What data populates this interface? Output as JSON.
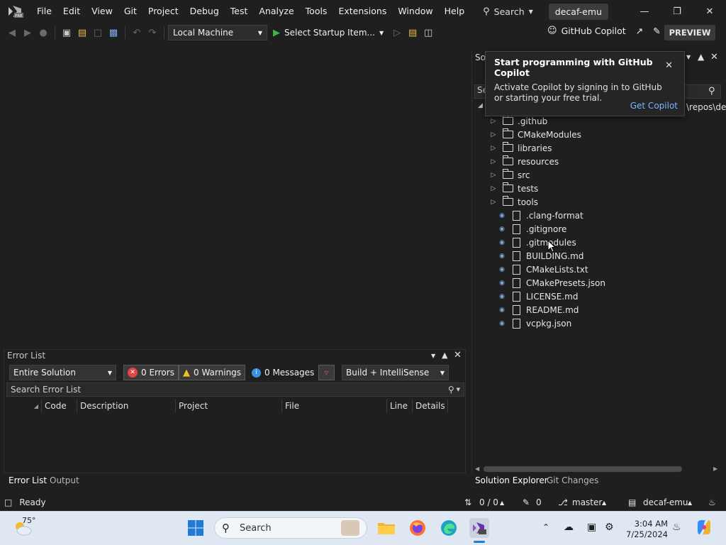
{
  "menubar": {
    "items": [
      "File",
      "Edit",
      "View",
      "Git",
      "Project",
      "Debug",
      "Test",
      "Analyze",
      "Tools",
      "Extensions",
      "Window",
      "Help"
    ],
    "search_label": "Search",
    "solution_name": "decaf-emu",
    "logo_badge": "PRE"
  },
  "toolbar": {
    "target": "Local Machine",
    "startup_label": "Select Startup Item...",
    "copilot_label": "GitHub Copilot",
    "preview_label": "PREVIEW"
  },
  "copilot_popup": {
    "title": "Start programming with GitHub Copilot",
    "text": "Activate Copilot by signing in to GitHub or starting your free trial.",
    "link": "Get Copilot"
  },
  "solution_explorer": {
    "header_partial": "Sol",
    "search_partial": "Se",
    "path_partial": "\\repos\\dec",
    "folders": [
      ".github",
      "CMakeModules",
      "libraries",
      "resources",
      "src",
      "tests",
      "tools"
    ],
    "files": [
      {
        "name": ".clang-format",
        "icon": "config-file-icon"
      },
      {
        "name": ".gitignore",
        "icon": "file-icon"
      },
      {
        "name": ".gitmodules",
        "icon": "file-icon"
      },
      {
        "name": "BUILDING.md",
        "icon": "markdown-file-icon"
      },
      {
        "name": "CMakeLists.txt",
        "icon": "text-file-icon"
      },
      {
        "name": "CMakePresets.json",
        "icon": "json-file-icon"
      },
      {
        "name": "LICENSE.md",
        "icon": "markdown-file-icon"
      },
      {
        "name": "README.md",
        "icon": "markdown-file-icon"
      },
      {
        "name": "vcpkg.json",
        "icon": "json-file-icon"
      }
    ]
  },
  "error_list": {
    "title": "Error List",
    "scope": "Entire Solution",
    "errors": "0 Errors",
    "warnings": "0 Warnings",
    "messages": "0 Messages",
    "source": "Build + IntelliSense",
    "search_placeholder": "Search Error List",
    "columns": [
      "Code",
      "Description",
      "Project",
      "File",
      "Line",
      "Details"
    ]
  },
  "bottom_tabs": {
    "left": [
      "Error List",
      "Output"
    ],
    "right": [
      "Solution Explorer",
      "Git Changes"
    ]
  },
  "statusbar": {
    "ready": "Ready",
    "lines": "0 / 0",
    "edits": "0",
    "branch": "master",
    "repo": "decaf-emu"
  },
  "taskbar": {
    "weather": "75°",
    "search": "Search",
    "time": "3:04 AM",
    "date": "7/25/2024"
  },
  "colors": {
    "accent": "#77b7ff",
    "error_red": "#e04545",
    "warning_yellow": "#f0c020",
    "info_blue": "#3d8fe0",
    "vs_purple": "#8a54c8"
  }
}
